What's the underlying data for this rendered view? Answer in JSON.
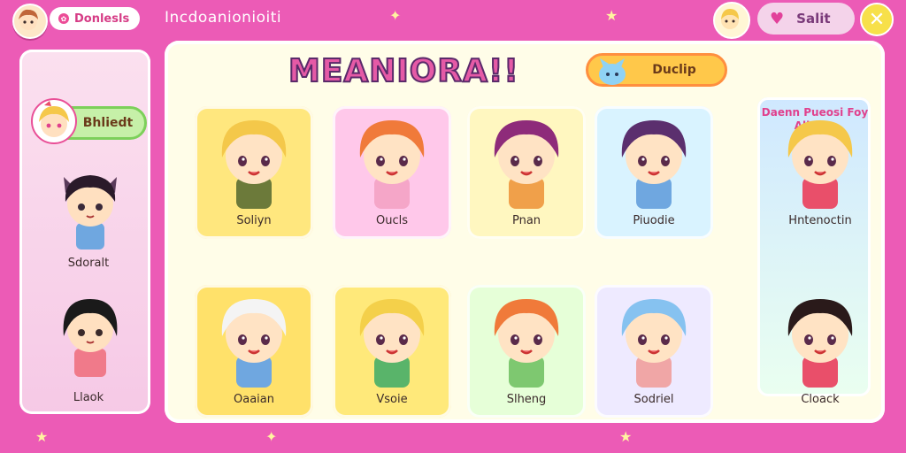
{
  "topbar": {
    "tab_label": "Donlesls",
    "title": "Incdoanionioiti",
    "score_label": "Salit"
  },
  "heading": "MEANIORA!!",
  "tags": {
    "side": "Bhliedt",
    "main": "Duclip"
  },
  "banner": "Daenn Pueosi Foy Aliebie",
  "side_characters": [
    {
      "name": "Sdoralt"
    },
    {
      "name": "Llaok"
    }
  ],
  "grid": [
    {
      "name": "Soliyn",
      "card": "#ffe77e",
      "hair": "#f4c84a",
      "outfit": "#6c7a3a"
    },
    {
      "name": "Oucls",
      "card": "#ffc8ea",
      "hair": "#f07a3a",
      "outfit": "#f5a6c8"
    },
    {
      "name": "Pnan",
      "card": "#fff7c0",
      "hair": "#8e2b7a",
      "outfit": "#f0a04a"
    },
    {
      "name": "Piuodie",
      "card": "#d9f3ff",
      "hair": "#5b2f6e",
      "outfit": "#6fa7e0"
    },
    {
      "name": "Hntenoctin",
      "card": "#e9fff0",
      "hair": "#f5c84a",
      "outfit": "#e94f6a"
    },
    {
      "name": "Oaaian",
      "card": "#ffe16a",
      "hair": "#f4f4f4",
      "outfit": "#6fa7e0"
    },
    {
      "name": "Vsoie",
      "card": "#ffe97a",
      "hair": "#f4d04a",
      "outfit": "#59b46a"
    },
    {
      "name": "Slheng",
      "card": "#e6ffd8",
      "hair": "#f07a3a",
      "outfit": "#7ec870"
    },
    {
      "name": "Sodriel",
      "card": "#eeeaff",
      "hair": "#86c2f0",
      "outfit": "#f0a6a6"
    },
    {
      "name": "Cloack",
      "card": "#f5ffe8",
      "hair": "#2a1a1a",
      "outfit": "#e94f6a"
    }
  ],
  "colors": {
    "background": "#ec5bb6",
    "accent": "#e55aa6",
    "panel": "#fffde8"
  }
}
